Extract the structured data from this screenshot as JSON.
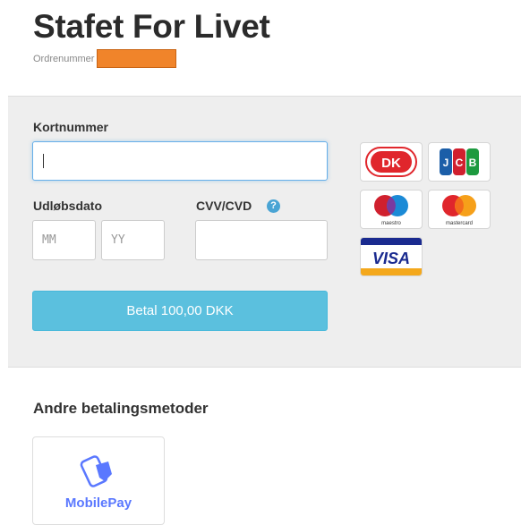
{
  "header": {
    "title": "Stafet For Livet",
    "order_label": "Ordrenummer"
  },
  "card_form": {
    "card_number_label": "Kortnummer",
    "card_number_value": "",
    "expiry_label": "Udløbsdato",
    "month_placeholder": "MM",
    "year_placeholder": "YY",
    "cvv_label": "CVV/CVD",
    "cvv_help": "?",
    "pay_button_label": "Betal 100,00 DKK"
  },
  "card_logos": [
    {
      "name": "dankort-icon",
      "text": "DK"
    },
    {
      "name": "jcb-icon",
      "text": "JCB"
    },
    {
      "name": "maestro-icon",
      "text": "maestro"
    },
    {
      "name": "mastercard-icon",
      "text": "mastercard"
    },
    {
      "name": "visa-icon",
      "text": "VISA"
    }
  ],
  "other_methods": {
    "heading": "Andre betalingsmetoder",
    "mobilepay_label": "MobilePay"
  },
  "colors": {
    "pay_button": "#5bc0de",
    "redaction": "#f0842a",
    "mobilepay": "#5a78ff"
  }
}
